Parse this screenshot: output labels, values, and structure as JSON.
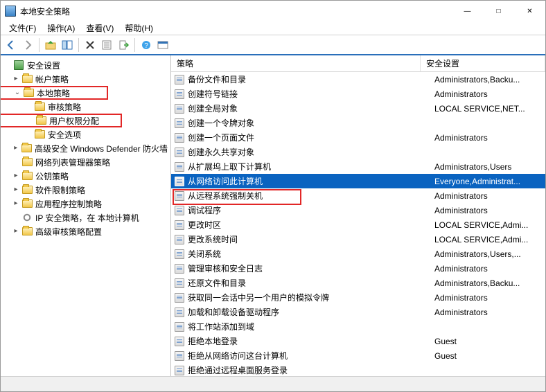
{
  "window": {
    "title": "本地安全策略"
  },
  "menu": {
    "file": "文件(F)",
    "action": "操作(A)",
    "view": "查看(V)",
    "help": "帮助(H)"
  },
  "tree": {
    "root": "安全设置",
    "account_policy": "帐户策略",
    "local_policy": "本地策略",
    "audit_policy": "审核策略",
    "user_rights": "用户权限分配",
    "security_options": "安全选项",
    "defender_fw": "高级安全 Windows Defender 防火墙",
    "nlm": "网络列表管理器策略",
    "pk": "公钥策略",
    "srp": "软件限制策略",
    "app_ctrl": "应用程序控制策略",
    "ipsec": "IP 安全策略，在 本地计算机",
    "adv_audit": "高级审核策略配置"
  },
  "columns": {
    "policy": "策略",
    "setting": "安全设置"
  },
  "rows": [
    {
      "name": "备份文件和目录",
      "setting": "Administrators,Backu..."
    },
    {
      "name": "创建符号链接",
      "setting": "Administrators"
    },
    {
      "name": "创建全局对象",
      "setting": "LOCAL SERVICE,NET..."
    },
    {
      "name": "创建一个令牌对象",
      "setting": ""
    },
    {
      "name": "创建一个页面文件",
      "setting": "Administrators"
    },
    {
      "name": "创建永久共享对象",
      "setting": ""
    },
    {
      "name": "从扩展坞上取下计算机",
      "setting": "Administrators,Users"
    },
    {
      "name": "从网络访问此计算机",
      "setting": "Everyone,Administrat...",
      "selected": true
    },
    {
      "name": "从远程系统强制关机",
      "setting": "Administrators"
    },
    {
      "name": "调试程序",
      "setting": "Administrators"
    },
    {
      "name": "更改时区",
      "setting": "LOCAL SERVICE,Admi..."
    },
    {
      "name": "更改系统时间",
      "setting": "LOCAL SERVICE,Admi..."
    },
    {
      "name": "关闭系统",
      "setting": "Administrators,Users,..."
    },
    {
      "name": "管理审核和安全日志",
      "setting": "Administrators"
    },
    {
      "name": "还原文件和目录",
      "setting": "Administrators,Backu..."
    },
    {
      "name": "获取同一会话中另一个用户的模拟令牌",
      "setting": "Administrators"
    },
    {
      "name": "加载和卸载设备驱动程序",
      "setting": "Administrators"
    },
    {
      "name": "将工作站添加到域",
      "setting": ""
    },
    {
      "name": "拒绝本地登录",
      "setting": "Guest"
    },
    {
      "name": "拒绝从网络访问这台计算机",
      "setting": "Guest"
    },
    {
      "name": "拒绝通过远程桌面服务登录",
      "setting": ""
    }
  ]
}
